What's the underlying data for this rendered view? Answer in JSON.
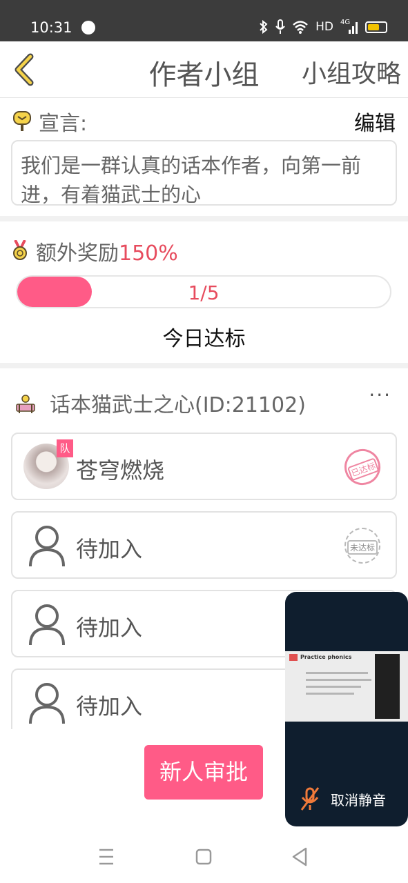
{
  "status_bar": {
    "time": "10:31",
    "network": "HD",
    "signal": "4G"
  },
  "header": {
    "title": "作者小组",
    "guide": "小组攻略"
  },
  "declaration": {
    "label": "宣言:",
    "edit": "编辑",
    "text": "我们是一群认真的话本作者，向第一前进，有着猫武士的心"
  },
  "reward": {
    "label": "额外奖励",
    "percent": "150%",
    "progress_text": "1/5",
    "progress_fraction": 0.2,
    "status": "今日达标"
  },
  "group": {
    "name": "话本猫武士之心(ID:21102)",
    "more": "···",
    "members": [
      {
        "name": "苍穹燃烧",
        "tag": "队",
        "stamp": "已达标"
      },
      {
        "name": "待加入",
        "stamp": "未达标"
      },
      {
        "name": "待加入"
      },
      {
        "name": "待加入"
      }
    ]
  },
  "approve_button": "新人审批",
  "video_call": {
    "slide_title": "Practice phonics",
    "unmute": "取消静音"
  },
  "colors": {
    "accent": "#ff5b87",
    "accent_text": "#e74c5e",
    "video_bg": "#0f1e2e"
  }
}
